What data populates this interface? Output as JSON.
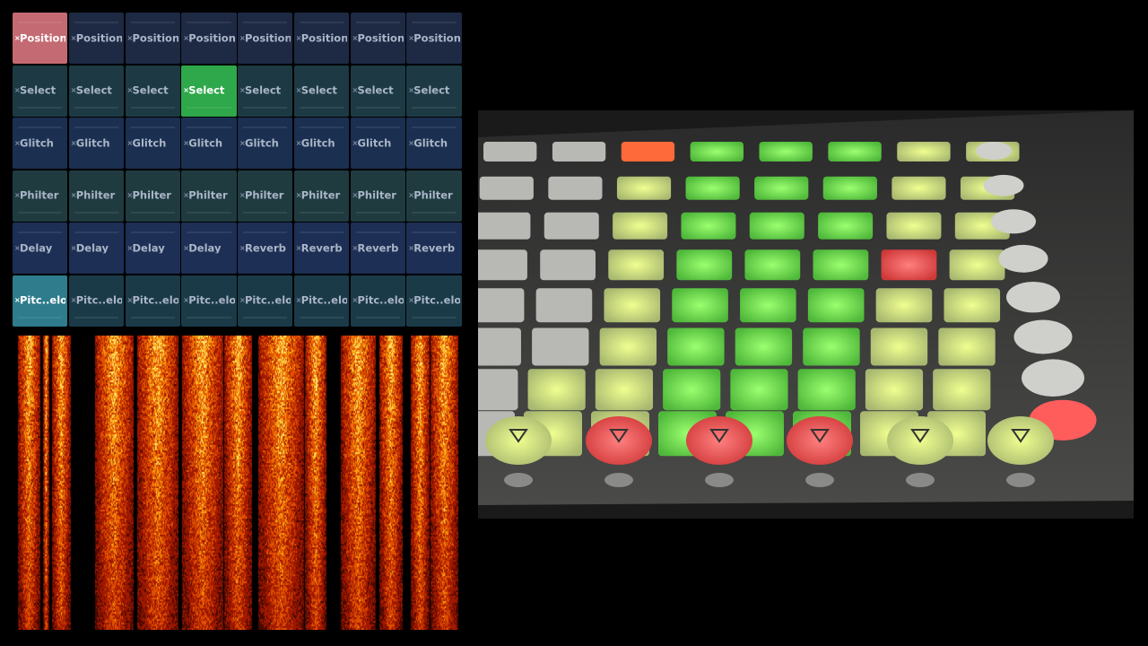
{
  "grid": {
    "rows": [
      {
        "color": "#1e2a44",
        "cells": [
          "Position",
          "Position",
          "Position",
          "Position",
          "Position",
          "Position",
          "Position",
          "Position"
        ],
        "active": 0,
        "active_color": "#c46a72"
      },
      {
        "color": "#1d3a44",
        "cells": [
          "Select",
          "Select",
          "Select",
          "Select",
          "Select",
          "Select",
          "Select",
          "Select"
        ],
        "active": 3,
        "active_color": "#2ea84a"
      },
      {
        "color": "#1b3050",
        "cells": [
          "Glitch",
          "Glitch",
          "Glitch",
          "Glitch",
          "Glitch",
          "Glitch",
          "Glitch",
          "Glitch"
        ],
        "active": -1
      },
      {
        "color": "#1f3b40",
        "cells": [
          "Philter",
          "Philter",
          "Philter",
          "Philter",
          "Philter",
          "Philter",
          "Philter",
          "Philter"
        ],
        "active": -1
      },
      {
        "color": "#1e2f55",
        "cells": [
          "Delay",
          "Delay",
          "Delay",
          "Delay",
          "Reverb",
          "Reverb",
          "Reverb",
          "Reverb"
        ],
        "active": -1
      },
      {
        "color": "#1b3a48",
        "cells": [
          "Pitc..elope",
          "Pitc..elope",
          "Pitc..elope",
          "Pitc..elope",
          "Pitc..elope",
          "Pitc..elope",
          "Pitc..elope",
          "Pitc..elope"
        ],
        "active": 0,
        "active_color": "#2e7c8c"
      }
    ]
  },
  "spectrogram": {
    "palette": [
      "#000000",
      "#6e0a00",
      "#c83000",
      "#f07800",
      "#ffd040"
    ]
  },
  "launchpad": {
    "pad_colors": {
      "off": "#b8b8b4",
      "green": "#7de85c",
      "yellow": "#d8e88a",
      "red": "#ff5c5c",
      "orange": "#ff6a3a"
    },
    "bottom_buttons": [
      "yellow",
      "red",
      "red",
      "red",
      "yellow",
      "yellow"
    ]
  }
}
